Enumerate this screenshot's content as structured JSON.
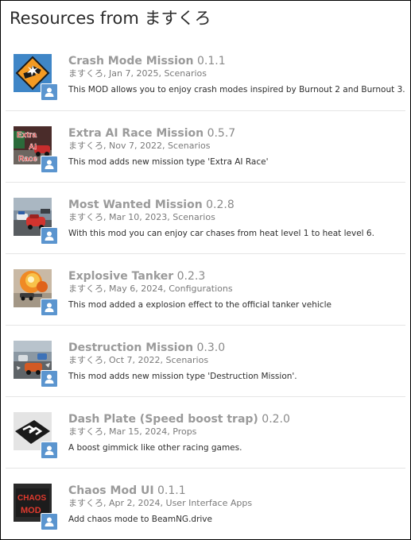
{
  "page": {
    "title": "Resources from ますくろ"
  },
  "resources": [
    {
      "title": "Crash Mode Mission",
      "version": "0.1.1",
      "author": "ますくろ",
      "date": "Jan 7, 2025",
      "category": "Scenarios",
      "description": "This MOD allows you to enjoy crash modes inspired by Burnout 2 and Burnout 3.",
      "thumb_icon": "crash-sign-thumbnail-icon"
    },
    {
      "title": "Extra AI Race Mission",
      "version": "0.5.7",
      "author": "ますくろ",
      "date": "Nov 7, 2022",
      "category": "Scenarios",
      "description": "This mod adds new mission type 'Extra AI Race'",
      "thumb_icon": "extra-ai-race-thumbnail-icon"
    },
    {
      "title": "Most Wanted Mission",
      "version": "0.2.8",
      "author": "ますくろ",
      "date": "Mar 10, 2023",
      "category": "Scenarios",
      "description": "With this mod you can enjoy car chases from heat level 1 to heat level 6.",
      "thumb_icon": "police-chase-thumbnail-icon"
    },
    {
      "title": "Explosive Tanker",
      "version": "0.2.3",
      "author": "ますくろ",
      "date": "May 6, 2024",
      "category": "Configurations",
      "description": "This mod added a explosion effect to the official tanker vehicle",
      "thumb_icon": "explosion-thumbnail-icon"
    },
    {
      "title": "Destruction Mission",
      "version": "0.3.0",
      "author": "ますくろ",
      "date": "Oct 7, 2022",
      "category": "Scenarios",
      "description": "This mod adds new mission type 'Destruction Mission'.",
      "thumb_icon": "destruction-thumbnail-icon"
    },
    {
      "title": "Dash Plate (Speed boost trap)",
      "version": "0.2.0",
      "author": "ますくろ",
      "date": "Mar 15, 2024",
      "category": "Props",
      "description": "A boost gimmick like other racing games.",
      "thumb_icon": "dash-plate-thumbnail-icon"
    },
    {
      "title": "Chaos Mod UI",
      "version": "0.1.1",
      "author": "ますくろ",
      "date": "Apr 2, 2024",
      "category": "User Interface Apps",
      "description": "Add chaos mode to BeamNG.drive",
      "thumb_icon": "chaos-mod-thumbnail-icon"
    }
  ],
  "thumb_texts": {
    "extra_ai_race": [
      "Extra",
      "AI",
      "Race"
    ],
    "chaos_mod": [
      "CHAOS",
      "MOD"
    ]
  },
  "colors": {
    "avatar_bg": "#5b95cf",
    "title_gray": "#9a9a9a"
  }
}
